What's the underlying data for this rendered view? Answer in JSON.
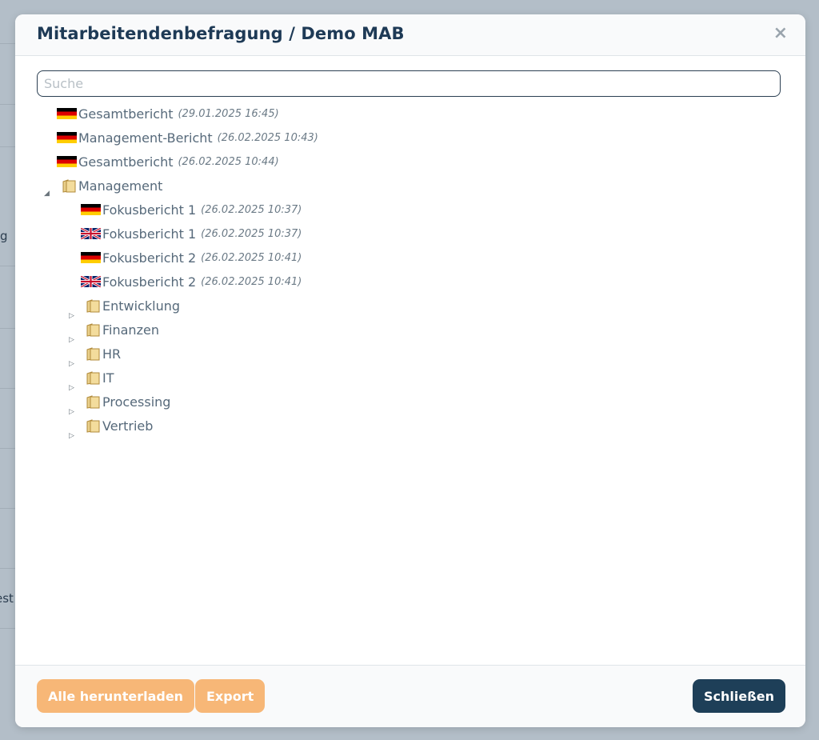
{
  "dialog": {
    "title": "Mitarbeitendenbefragung / Demo MAB",
    "close_glyph": "×",
    "search_placeholder": "Suche"
  },
  "background_fragments": [
    "g",
    "est"
  ],
  "tree": {
    "reports": [
      {
        "name": "Gesamtbericht",
        "date": "(29.01.2025 16:45)",
        "flag": "de"
      },
      {
        "name": "Management-Bericht",
        "date": "(26.02.2025 10:43)",
        "flag": "de"
      },
      {
        "name": "Gesamtbericht",
        "date": "(26.02.2025 10:44)",
        "flag": "de"
      }
    ],
    "management_folder": {
      "name": "Management",
      "expanded": true,
      "children": [
        {
          "name": "Fokusbericht 1",
          "date": "(26.02.2025 10:37)",
          "flag": "de"
        },
        {
          "name": "Fokusbericht 1",
          "date": "(26.02.2025 10:37)",
          "flag": "gb"
        },
        {
          "name": "Fokusbericht 2",
          "date": "(26.02.2025 10:41)",
          "flag": "de"
        },
        {
          "name": "Fokusbericht 2",
          "date": "(26.02.2025 10:41)",
          "flag": "gb"
        }
      ],
      "subfolders": [
        "Entwicklung",
        "Finanzen",
        "HR",
        "IT",
        "Processing",
        "Vertrieb"
      ]
    }
  },
  "footer": {
    "download_all_label": "Alle herunterladen",
    "export_label": "Export",
    "close_label": "Schließen"
  },
  "colors": {
    "accent_orange": "#f7b777",
    "primary_dark": "#1e3f58",
    "title": "#1e3a56",
    "overlay": "#b5c0c9"
  },
  "icons": {
    "flag_de": "german-flag-icon",
    "flag_gb": "uk-flag-icon",
    "folder": "folder-icon",
    "expanded": "triangle-down-icon",
    "collapsed": "triangle-right-icon"
  }
}
